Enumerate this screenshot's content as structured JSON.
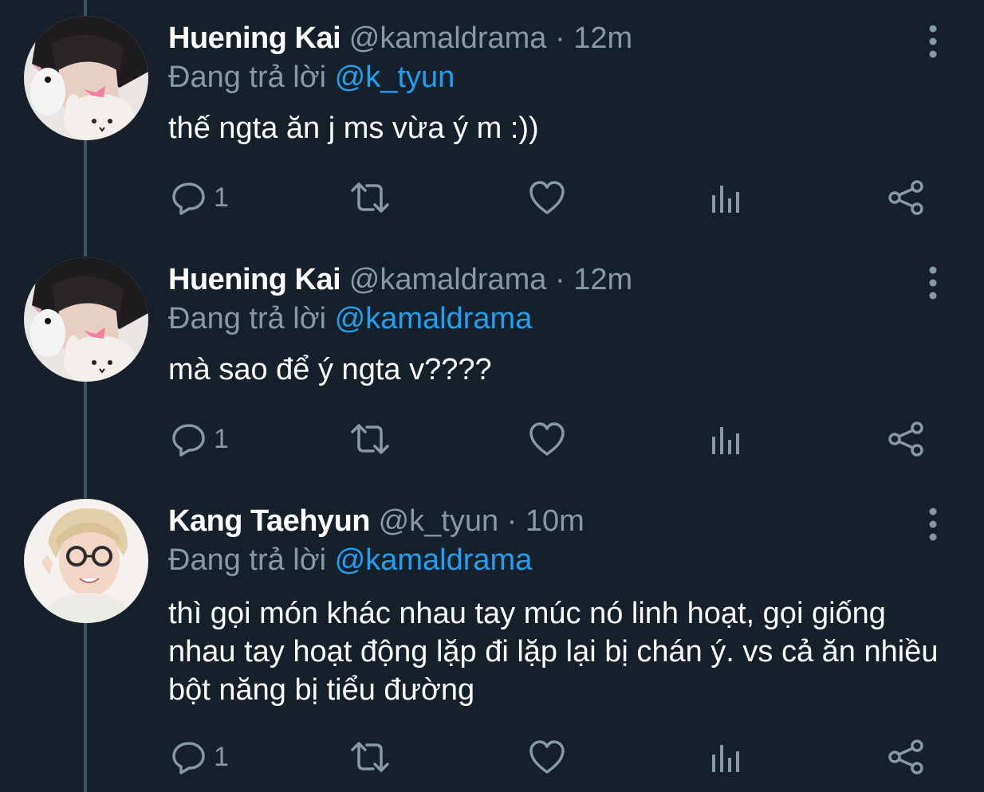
{
  "tweets": [
    {
      "name": "Huening Kai",
      "handle": "@kamaldrama",
      "separator": "·",
      "time": "12m",
      "replying_label": "Đang trả lời",
      "replying_to": "@k_tyun",
      "text": "thế ngta ăn j ms vừa ý m :))",
      "reply_count": "1",
      "avatar": "avatar-huening-kai"
    },
    {
      "name": "Huening Kai",
      "handle": "@kamaldrama",
      "separator": "·",
      "time": "12m",
      "replying_label": "Đang trả lời",
      "replying_to": "@kamaldrama",
      "text": "mà sao để ý ngta v????",
      "reply_count": "1",
      "avatar": "avatar-huening-kai"
    },
    {
      "name": "Kang Taehyun",
      "handle": "@k_tyun",
      "separator": "·",
      "time": "10m",
      "replying_label": "Đang trả lời",
      "replying_to": "@kamaldrama",
      "text": "thì gọi món khác nhau tay múc nó linh hoạt, gọi giống nhau tay hoạt động lặp đi lặp lại bị chán ý. vs cả ăn nhiều bột năng bị tiểu đường",
      "reply_count": "1",
      "avatar": "avatar-kang-taehyun"
    }
  ],
  "icons": {
    "reply": "reply-icon",
    "retweet": "retweet-icon",
    "like": "heart-icon",
    "analytics": "analytics-icon",
    "share": "share-icon",
    "more": "more-vertical-icon"
  },
  "colors": {
    "background": "#15202b",
    "text_primary": "#ffffff",
    "text_secondary": "#8899a6",
    "accent": "#1da1f2",
    "thread_line": "#3d5466"
  }
}
